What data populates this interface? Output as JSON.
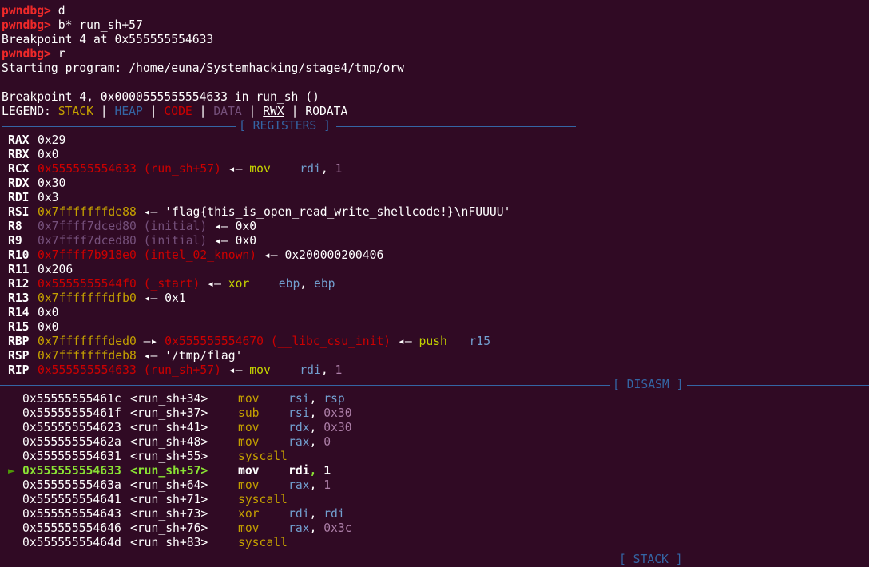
{
  "session": {
    "prompt": "pwndbg>",
    "commands": [
      {
        "cmd": " d"
      },
      {
        "cmd": " b* run_sh+57"
      },
      {
        "output": "Breakpoint 4 at 0x555555554633"
      },
      {
        "cmd": " r"
      },
      {
        "output": "Starting program: /home/euna/Systemhacking/stage4/tmp/orw"
      },
      {
        "output": ""
      },
      {
        "output": "Breakpoint 4, 0x0000555555554633 in run_sh ()"
      }
    ]
  },
  "legend": {
    "label": "LEGEND:",
    "stack": "STACK",
    "heap": "HEAP",
    "code": "CODE",
    "data": "DATA",
    "rwx": "RWX",
    "rodata": "RODATA",
    "sep": " | "
  },
  "sections": {
    "registers": "[ REGISTERS ]",
    "disasm": "[ DISASM ]",
    "stack": "[ STACK ]"
  },
  "registers": [
    {
      "name": "RAX",
      "value": "0x29",
      "color": "plain"
    },
    {
      "name": "RBX",
      "value": "0x0",
      "color": "plain"
    },
    {
      "name": "RCX",
      "value": "0x555555554633 (run_sh+57)",
      "color": "code",
      "arrow": "◂—",
      "mnem": "mov",
      "ops": [
        [
          "rdi",
          "reg"
        ],
        [
          ", ",
          "plain"
        ],
        [
          "1",
          "imm"
        ]
      ]
    },
    {
      "name": "RDX",
      "value": "0x30",
      "color": "plain"
    },
    {
      "name": "RDI",
      "value": "0x3",
      "color": "plain"
    },
    {
      "name": "RSI",
      "value": "0x7fffffffde88",
      "color": "stack",
      "arrow": "◂—",
      "tail": "'flag{this_is_open_read_write_shellcode!}\\nFUUUU'"
    },
    {
      "name": "R8",
      "value": "0x7ffff7dced80 (initial)",
      "color": "data",
      "arrow": "◂—",
      "tail": "0x0"
    },
    {
      "name": "R9",
      "value": "0x7ffff7dced80 (initial)",
      "color": "data",
      "arrow": "◂—",
      "tail": "0x0"
    },
    {
      "name": "R10",
      "value": "0x7ffff7b918e0 (intel_02_known)",
      "color": "code",
      "arrow": "◂—",
      "tail": "0x200000200406"
    },
    {
      "name": "R11",
      "value": "0x206",
      "color": "plain"
    },
    {
      "name": "R12",
      "value": "0x5555555544f0 (_start)",
      "color": "code",
      "arrow": "◂—",
      "mnem": "xor",
      "ops": [
        [
          "ebp",
          "reg"
        ],
        [
          ", ",
          "plain"
        ],
        [
          "ebp",
          "reg"
        ]
      ]
    },
    {
      "name": "R13",
      "value": "0x7fffffffdfb0",
      "color": "stack",
      "arrow": "◂—",
      "tail": "0x1"
    },
    {
      "name": "R14",
      "value": "0x0",
      "color": "plain"
    },
    {
      "name": "R15",
      "value": "0x0",
      "color": "plain"
    },
    {
      "name": "RBP",
      "value": "0x7fffffffded0",
      "color": "stack",
      "arrow": "—▸",
      "value2": "0x555555554670 (__libc_csu_init)",
      "arrow2": "◂—",
      "mnem": "push",
      "ops": [
        [
          "r15",
          "reg"
        ]
      ]
    },
    {
      "name": "RSP",
      "value": "0x7fffffffdeb8",
      "color": "stack",
      "arrow": "◂—",
      "tail": "'/tmp/flag'"
    },
    {
      "name": "RIP",
      "value": "0x555555554633 (run_sh+57)",
      "color": "code",
      "arrow": "◂—",
      "mnem": "mov",
      "ops": [
        [
          "rdi",
          "reg"
        ],
        [
          ", ",
          "plain"
        ],
        [
          "1",
          "imm"
        ]
      ]
    }
  ],
  "disasm": [
    {
      "addr": "0x55555555461c",
      "sym": "<run_sh+34>",
      "mnem": "mov",
      "ops": [
        [
          "rsi",
          "reg"
        ],
        [
          ", ",
          "plain"
        ],
        [
          "rsp",
          "reg"
        ]
      ]
    },
    {
      "addr": "0x55555555461f",
      "sym": "<run_sh+37>",
      "mnem": "sub",
      "ops": [
        [
          "rsi",
          "reg"
        ],
        [
          ", ",
          "plain"
        ],
        [
          "0x30",
          "imm"
        ]
      ]
    },
    {
      "addr": "0x555555554623",
      "sym": "<run_sh+41>",
      "mnem": "mov",
      "ops": [
        [
          "rdx",
          "reg"
        ],
        [
          ", ",
          "plain"
        ],
        [
          "0x30",
          "imm"
        ]
      ]
    },
    {
      "addr": "0x55555555462a",
      "sym": "<run_sh+48>",
      "mnem": "mov",
      "ops": [
        [
          "rax",
          "reg"
        ],
        [
          ", ",
          "plain"
        ],
        [
          "0",
          "imm"
        ]
      ]
    },
    {
      "addr": "0x555555554631",
      "sym": "<run_sh+55>",
      "mnem": "syscall",
      "ops": []
    },
    {
      "addr": "0x555555554633",
      "sym": "<run_sh+57>",
      "mnem": "mov",
      "ops": [
        [
          "rdi",
          "reg"
        ],
        [
          ", ",
          "plain"
        ],
        [
          "1",
          "imm"
        ]
      ],
      "current": true,
      "marker": "►"
    },
    {
      "addr": "0x55555555463a",
      "sym": "<run_sh+64>",
      "mnem": "mov",
      "ops": [
        [
          "rax",
          "reg"
        ],
        [
          ", ",
          "plain"
        ],
        [
          "1",
          "imm"
        ]
      ]
    },
    {
      "addr": "0x555555554641",
      "sym": "<run_sh+71>",
      "mnem": "syscall",
      "ops": []
    },
    {
      "addr": "0x555555554643",
      "sym": "<run_sh+73>",
      "mnem": "xor",
      "ops": [
        [
          "rdi",
          "reg"
        ],
        [
          ", ",
          "plain"
        ],
        [
          "rdi",
          "reg"
        ]
      ]
    },
    {
      "addr": "0x555555554646",
      "sym": "<run_sh+76>",
      "mnem": "mov",
      "ops": [
        [
          "rax",
          "reg"
        ],
        [
          ", ",
          "plain"
        ],
        [
          "0x3c",
          "imm"
        ]
      ]
    },
    {
      "addr": "0x55555555464d",
      "sym": "<run_sh+83>",
      "mnem": "syscall",
      "ops": []
    }
  ],
  "colors": {
    "background": "#300a24",
    "prompt": "#ef2929",
    "stack": "#c4a000",
    "heap": "#3465a4",
    "code": "#cc0000",
    "data": "#75507b",
    "separator": "#3465a4",
    "current": "#8ae234"
  }
}
